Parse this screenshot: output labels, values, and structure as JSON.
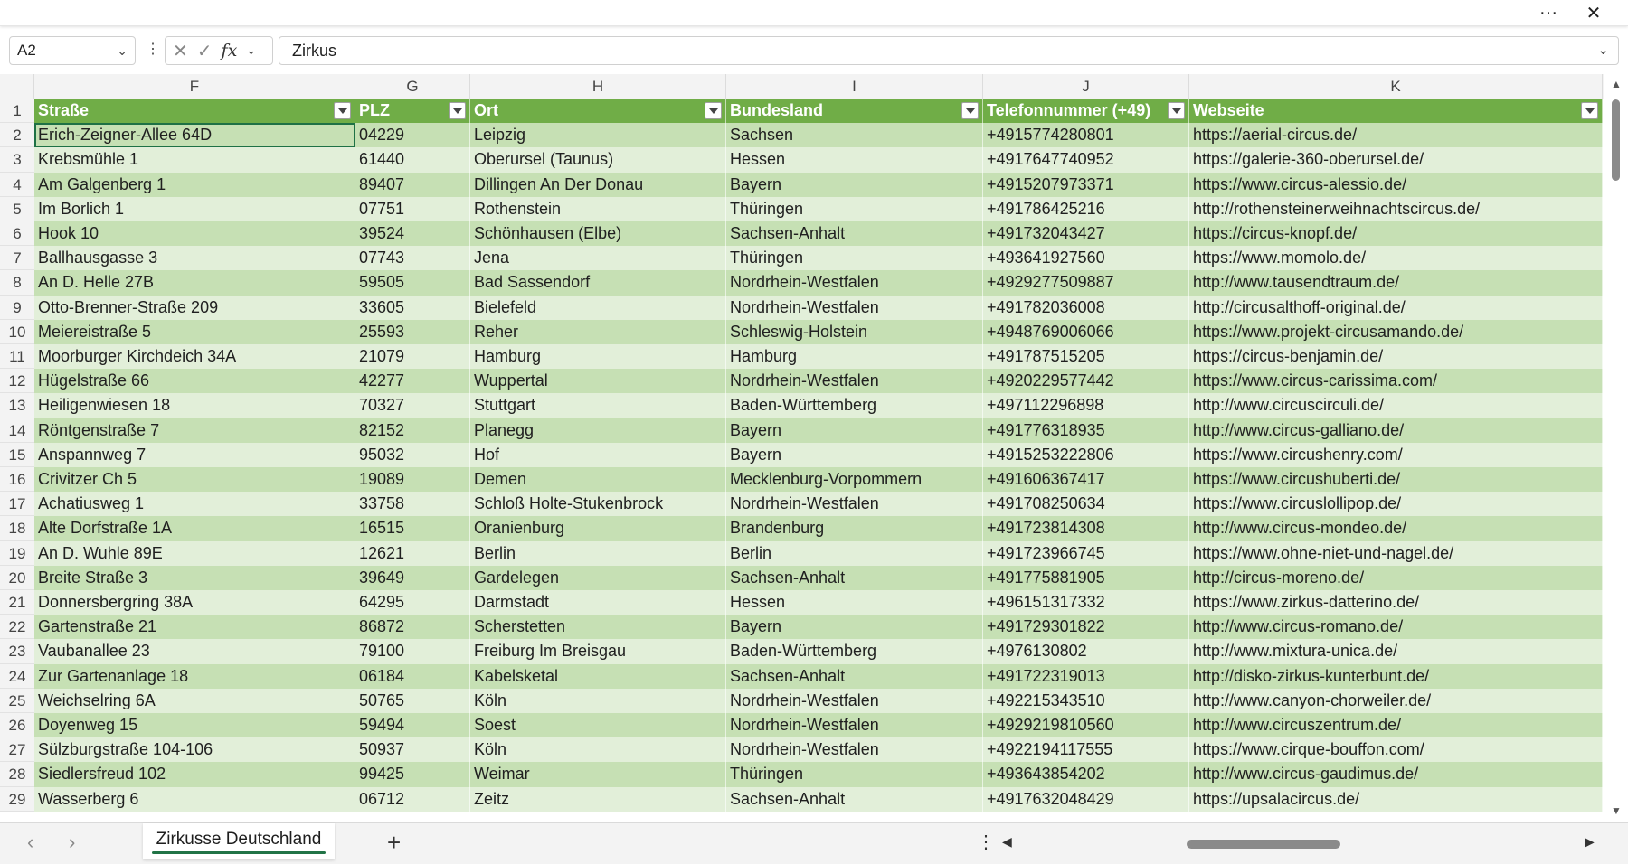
{
  "topbar": {
    "more_icon": "more-icon",
    "more_label": "···",
    "close_label": "✕"
  },
  "formula_bar": {
    "name_box": "A2",
    "cancel_label": "✕",
    "enter_label": "✓",
    "fx_label": "fx",
    "value": "Zirkus"
  },
  "columns": [
    {
      "letter": "F",
      "width": 355
    },
    {
      "letter": "G",
      "width": 127
    },
    {
      "letter": "H",
      "width": 283
    },
    {
      "letter": "I",
      "width": 284
    },
    {
      "letter": "J",
      "width": 228
    },
    {
      "letter": "K",
      "width": 457
    }
  ],
  "header_row": {
    "num": "1",
    "cells": [
      "Straße",
      "PLZ",
      "Ort",
      "Bundesland",
      "Telefonnummer (+49)",
      "Webseite"
    ]
  },
  "rows": [
    {
      "num": "2",
      "cells": [
        "Erich-Zeigner-Allee 64D",
        "04229",
        "Leipzig",
        "Sachsen",
        "+4915774280801",
        "https://aerial-circus.de/"
      ]
    },
    {
      "num": "3",
      "cells": [
        "Krebsmühle 1",
        "61440",
        "Oberursel (Taunus)",
        "Hessen",
        "+4917647740952",
        "https://galerie-360-oberursel.de/"
      ]
    },
    {
      "num": "4",
      "cells": [
        "Am Galgenberg 1",
        "89407",
        "Dillingen An Der Donau",
        "Bayern",
        "+4915207973371",
        "https://www.circus-alessio.de/"
      ]
    },
    {
      "num": "5",
      "cells": [
        "Im Borlich 1",
        "07751",
        "Rothenstein",
        "Thüringen",
        "+491786425216",
        "http://rothensteinerweihnachtscircus.de/"
      ]
    },
    {
      "num": "6",
      "cells": [
        "Hook 10",
        "39524",
        "Schönhausen (Elbe)",
        "Sachsen-Anhalt",
        "+491732043427",
        "https://circus-knopf.de/"
      ]
    },
    {
      "num": "7",
      "cells": [
        "Ballhausgasse 3",
        "07743",
        "Jena",
        "Thüringen",
        "+493641927560",
        "https://www.momolo.de/"
      ]
    },
    {
      "num": "8",
      "cells": [
        "An D. Helle 27B",
        "59505",
        "Bad Sassendorf",
        "Nordrhein-Westfalen",
        "+4929277509887",
        "http://www.tausendtraum.de/"
      ]
    },
    {
      "num": "9",
      "cells": [
        "Otto-Brenner-Straße 209",
        "33605",
        "Bielefeld",
        "Nordrhein-Westfalen",
        "+491782036008",
        "http://circusalthoff-original.de/"
      ]
    },
    {
      "num": "10",
      "cells": [
        "Meiereistraße 5",
        "25593",
        "Reher",
        "Schleswig-Holstein",
        "+4948769006066",
        "https://www.projekt-circusamando.de/"
      ]
    },
    {
      "num": "11",
      "cells": [
        "Moorburger Kirchdeich 34A",
        "21079",
        "Hamburg",
        "Hamburg",
        "+491787515205",
        "https://circus-benjamin.de/"
      ]
    },
    {
      "num": "12",
      "cells": [
        "Hügelstraße 66",
        "42277",
        "Wuppertal",
        "Nordrhein-Westfalen",
        "+4920229577442",
        "https://www.circus-carissima.com/"
      ]
    },
    {
      "num": "13",
      "cells": [
        "Heiligenwiesen 18",
        "70327",
        "Stuttgart",
        "Baden-Württemberg",
        "+497112296898",
        "http://www.circuscirculi.de/"
      ]
    },
    {
      "num": "14",
      "cells": [
        "Röntgenstraße 7",
        "82152",
        "Planegg",
        "Bayern",
        "+491776318935",
        "http://www.circus-galliano.de/"
      ]
    },
    {
      "num": "15",
      "cells": [
        "Anspannweg 7",
        "95032",
        "Hof",
        "Bayern",
        "+4915253222806",
        "https://www.circushenry.com/"
      ]
    },
    {
      "num": "16",
      "cells": [
        "Crivitzer Ch 5",
        "19089",
        "Demen",
        "Mecklenburg-Vorpommern",
        "+491606367417",
        "https://www.circushuberti.de/"
      ]
    },
    {
      "num": "17",
      "cells": [
        "Achatiusweg 1",
        "33758",
        "Schloß Holte-Stukenbrock",
        "Nordrhein-Westfalen",
        "+491708250634",
        "https://www.circuslollipop.de/"
      ]
    },
    {
      "num": "18",
      "cells": [
        "Alte Dorfstraße 1A",
        "16515",
        "Oranienburg",
        "Brandenburg",
        "+491723814308",
        "http://www.circus-mondeo.de/"
      ]
    },
    {
      "num": "19",
      "cells": [
        "An D. Wuhle 89E",
        "12621",
        "Berlin",
        "Berlin",
        "+491723966745",
        "https://www.ohne-niet-und-nagel.de/"
      ]
    },
    {
      "num": "20",
      "cells": [
        "Breite Straße 3",
        "39649",
        "Gardelegen",
        "Sachsen-Anhalt",
        "+491775881905",
        "http://circus-moreno.de/"
      ]
    },
    {
      "num": "21",
      "cells": [
        "Donnersbergring 38A",
        "64295",
        "Darmstadt",
        "Hessen",
        "+496151317332",
        "https://www.zirkus-datterino.de/"
      ]
    },
    {
      "num": "22",
      "cells": [
        "Gartenstraße 21",
        "86872",
        "Scherstetten",
        "Bayern",
        "+491729301822",
        "http://www.circus-romano.de/"
      ]
    },
    {
      "num": "23",
      "cells": [
        "Vaubanallee 23",
        "79100",
        "Freiburg Im Breisgau",
        "Baden-Württemberg",
        "+4976130802",
        "http://www.mixtura-unica.de/"
      ]
    },
    {
      "num": "24",
      "cells": [
        "Zur Gartenanlage 18",
        "06184",
        "Kabelsketal",
        "Sachsen-Anhalt",
        "+491722319013",
        "http://disko-zirkus-kunterbunt.de/"
      ]
    },
    {
      "num": "25",
      "cells": [
        "Weichselring 6A",
        "50765",
        "Köln",
        "Nordrhein-Westfalen",
        "+492215343510",
        "http://www.canyon-chorweiler.de/"
      ]
    },
    {
      "num": "26",
      "cells": [
        "Doyenweg 15",
        "59494",
        "Soest",
        "Nordrhein-Westfalen",
        "+4929219810560",
        "http://www.circuszentrum.de/"
      ]
    },
    {
      "num": "27",
      "cells": [
        "Sülzburgstraße 104-106",
        "50937",
        "Köln",
        "Nordrhein-Westfalen",
        "+4922194117555",
        "https://www.cirque-bouffon.com/"
      ]
    },
    {
      "num": "28",
      "cells": [
        "Siedlersfreud 102",
        "99425",
        "Weimar",
        "Thüringen",
        "+493643854202",
        "http://www.circus-gaudimus.de/"
      ]
    },
    {
      "num": "29",
      "cells": [
        "Wasserberg 6",
        "06712",
        "Zeitz",
        "Sachsen-Anhalt",
        "+4917632048429",
        "https://upsalacircus.de/"
      ]
    }
  ],
  "sheet_tabs": [
    {
      "label": "Zirkusse Deutschland"
    }
  ],
  "bottombar": {
    "prev_label": "‹",
    "next_label": "›",
    "add_label": "+",
    "dots_label": "⋮",
    "scroll_left": "◀",
    "scroll_right": "▶"
  },
  "colors": {
    "header_green": "#70ad47",
    "band_dark": "#c6e0b4",
    "band_light": "#e2efd9",
    "accent": "#217346"
  }
}
